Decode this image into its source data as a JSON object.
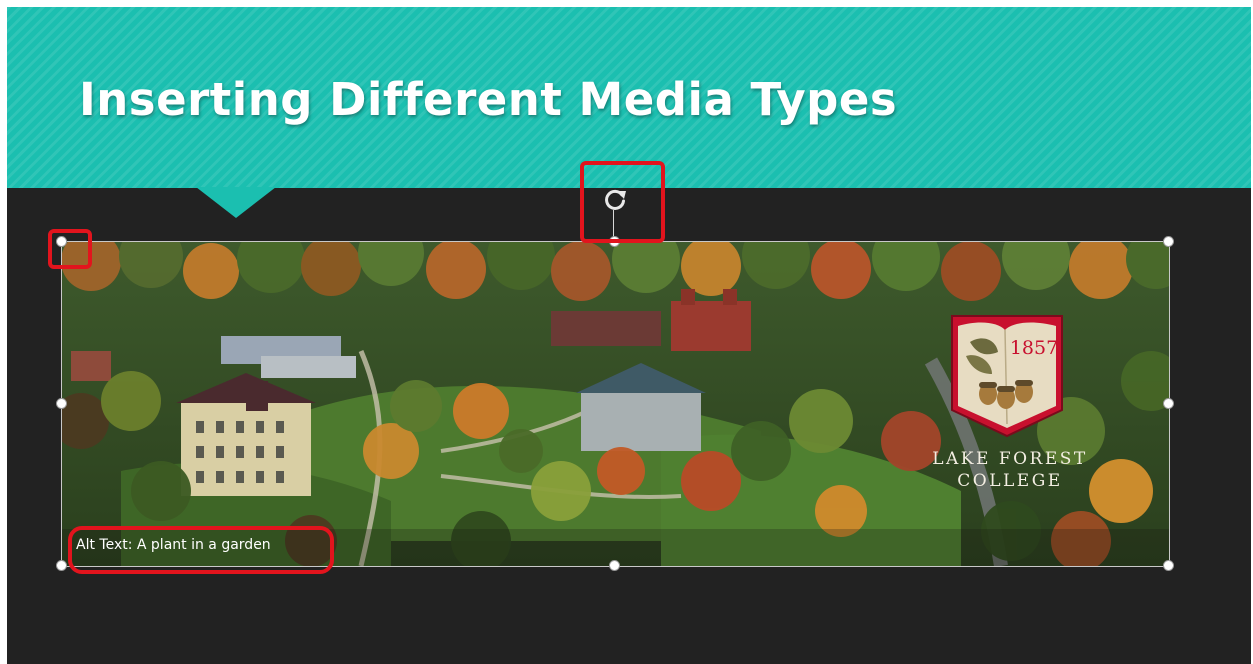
{
  "slide": {
    "title": "Inserting Different Media Types"
  },
  "picture": {
    "alt_text_caption": "Alt Text: A plant in a garden",
    "seal_year": "1857",
    "college_name_line1": "LAKE FOREST",
    "college_name_line2": "COLLEGE"
  },
  "icons": {
    "rotate": "rotate-handle-icon"
  },
  "colors": {
    "title_band": "#1bbfb0",
    "slide_background": "#222222",
    "highlight": "#e2141d",
    "seal_red": "#c8102e"
  }
}
